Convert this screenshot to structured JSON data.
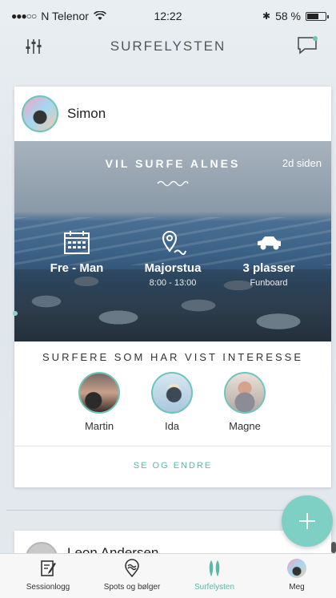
{
  "status": {
    "carrier": "N Telenor",
    "time": "12:22",
    "battery": "58 %",
    "battery_level": 0.58
  },
  "nav": {
    "title": "SURFELYSTEN"
  },
  "card": {
    "user": "Simon",
    "title": "VIL SURFE ALNES",
    "time_ago": "2d siden",
    "days": "Fre - Man",
    "place": "Majorstua",
    "time_range": "8:00 - 13:00",
    "seats": "3 plasser",
    "board": "Funboard",
    "interest_title": "SURFERE SOM HAR VIST INTERESSE",
    "people": [
      {
        "name": "Martin"
      },
      {
        "name": "Ida"
      },
      {
        "name": "Magne"
      }
    ],
    "action": "SE OG ENDRE"
  },
  "next_card": {
    "user": "Leon Andersen"
  },
  "tabs": [
    {
      "label": "Sessionlogg",
      "icon": "notebook-icon"
    },
    {
      "label": "Spots og bølger",
      "icon": "location-wave-icon"
    },
    {
      "label": "Surfelysten",
      "icon": "surfboards-icon"
    },
    {
      "label": "Meg",
      "icon": "profile-avatar-icon"
    }
  ],
  "colors": {
    "accent": "#6cc6b9",
    "fab": "#7fd0c4"
  }
}
